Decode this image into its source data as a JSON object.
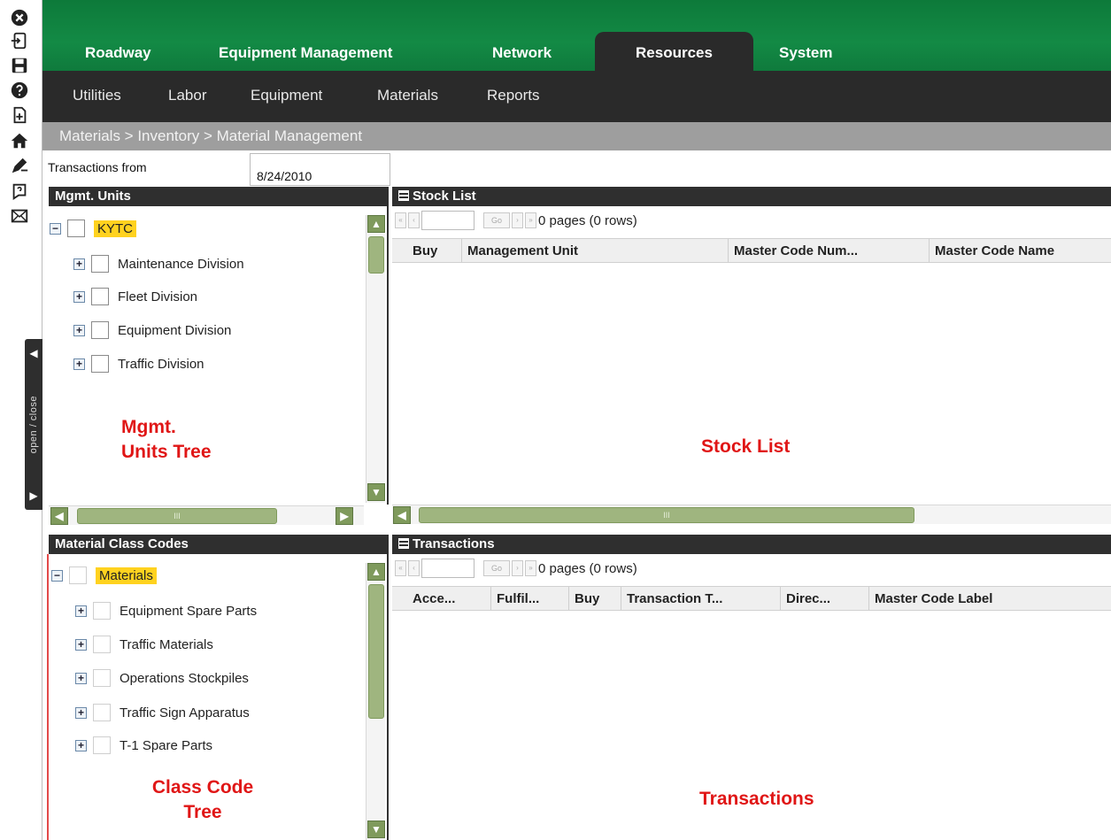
{
  "rail": {
    "toggle_label": "open / close",
    "icons": [
      "close-icon",
      "logout-icon",
      "save-icon",
      "help-icon",
      "add-page-icon",
      "home-icon",
      "edit-icon",
      "question-bubble-icon",
      "mail-icon"
    ]
  },
  "nav": {
    "tabs": [
      {
        "label": "Roadway"
      },
      {
        "label": "Equipment Management"
      },
      {
        "label": "Network"
      },
      {
        "label": "Resources"
      },
      {
        "label": "System"
      }
    ],
    "subtabs": [
      {
        "label": "Utilities"
      },
      {
        "label": "Labor"
      },
      {
        "label": "Equipment"
      },
      {
        "label": "Materials"
      },
      {
        "label": "Reports"
      }
    ],
    "breadcrumb": "Materials > Inventory > Material Management"
  },
  "filter": {
    "label": "Transactions from",
    "value": "8/24/2010"
  },
  "mgmt_units": {
    "title": "Mgmt. Units",
    "root": "KYTC",
    "children": [
      "Maintenance Division",
      "Fleet Division",
      "Equipment Division",
      "Traffic Division"
    ],
    "annotation_line1": "Mgmt.",
    "annotation_line2": "Units Tree"
  },
  "class_codes": {
    "title": "Material Class Codes",
    "root": "Materials",
    "children": [
      "Equipment Spare Parts",
      "Traffic Materials",
      "Operations Stockpiles",
      "Traffic Sign Apparatus",
      "T-1 Spare Parts"
    ],
    "annotation_line1": "Class Code",
    "annotation_line2": "Tree"
  },
  "stock_list": {
    "title": "Stock List",
    "pager_go": "Go",
    "pager_text": "0 pages (0 rows)",
    "columns": [
      "Buy",
      "Management Unit",
      "Master Code Num...",
      "Master Code Name"
    ],
    "annotation": "Stock List"
  },
  "transactions": {
    "title": "Transactions",
    "pager_go": "Go",
    "pager_text": "0 pages (0 rows)",
    "columns": [
      "Acce...",
      "Fulfil...",
      "Buy",
      "Transaction T...",
      "Direc...",
      "Master Code Label"
    ],
    "annotation": "Transactions"
  },
  "scroll": {
    "thumb_grip": "III"
  },
  "colors": {
    "nav_green": "#0f7a3c",
    "dark_bar": "#2a2a2a",
    "breadcrumb_gray": "#9e9e9e",
    "highlight": "#ffd21f",
    "scroll_green": "#7f9a5c",
    "annotation_red": "#e01616"
  }
}
